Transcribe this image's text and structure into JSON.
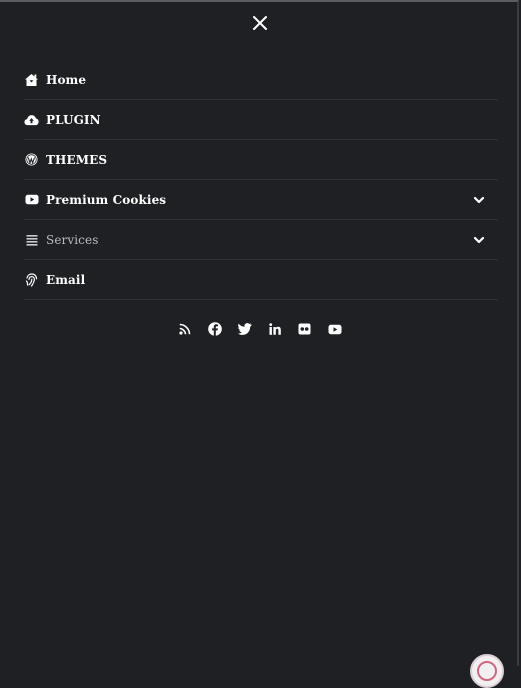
{
  "menu": {
    "items": [
      {
        "label": "Home",
        "icon": "home-icon"
      },
      {
        "label": "PLUGIN",
        "icon": "cloud-upload-icon"
      },
      {
        "label": "THEMES",
        "icon": "wordpress-icon"
      },
      {
        "label": "Premium Cookies",
        "icon": "youtube-icon",
        "has_submenu": true
      },
      {
        "label": "Services",
        "icon": "list-icon",
        "has_submenu": true
      },
      {
        "label": "Email",
        "icon": "fingerprint-icon"
      }
    ]
  },
  "social": {
    "icons": [
      "rss-icon",
      "facebook-icon",
      "twitter-icon",
      "linkedin-icon",
      "flickr-icon",
      "youtube-icon"
    ]
  },
  "colors": {
    "background": "#1f2024",
    "text": "#ffffff",
    "muted_text": "#b9bcc2",
    "divider": "#303136"
  }
}
